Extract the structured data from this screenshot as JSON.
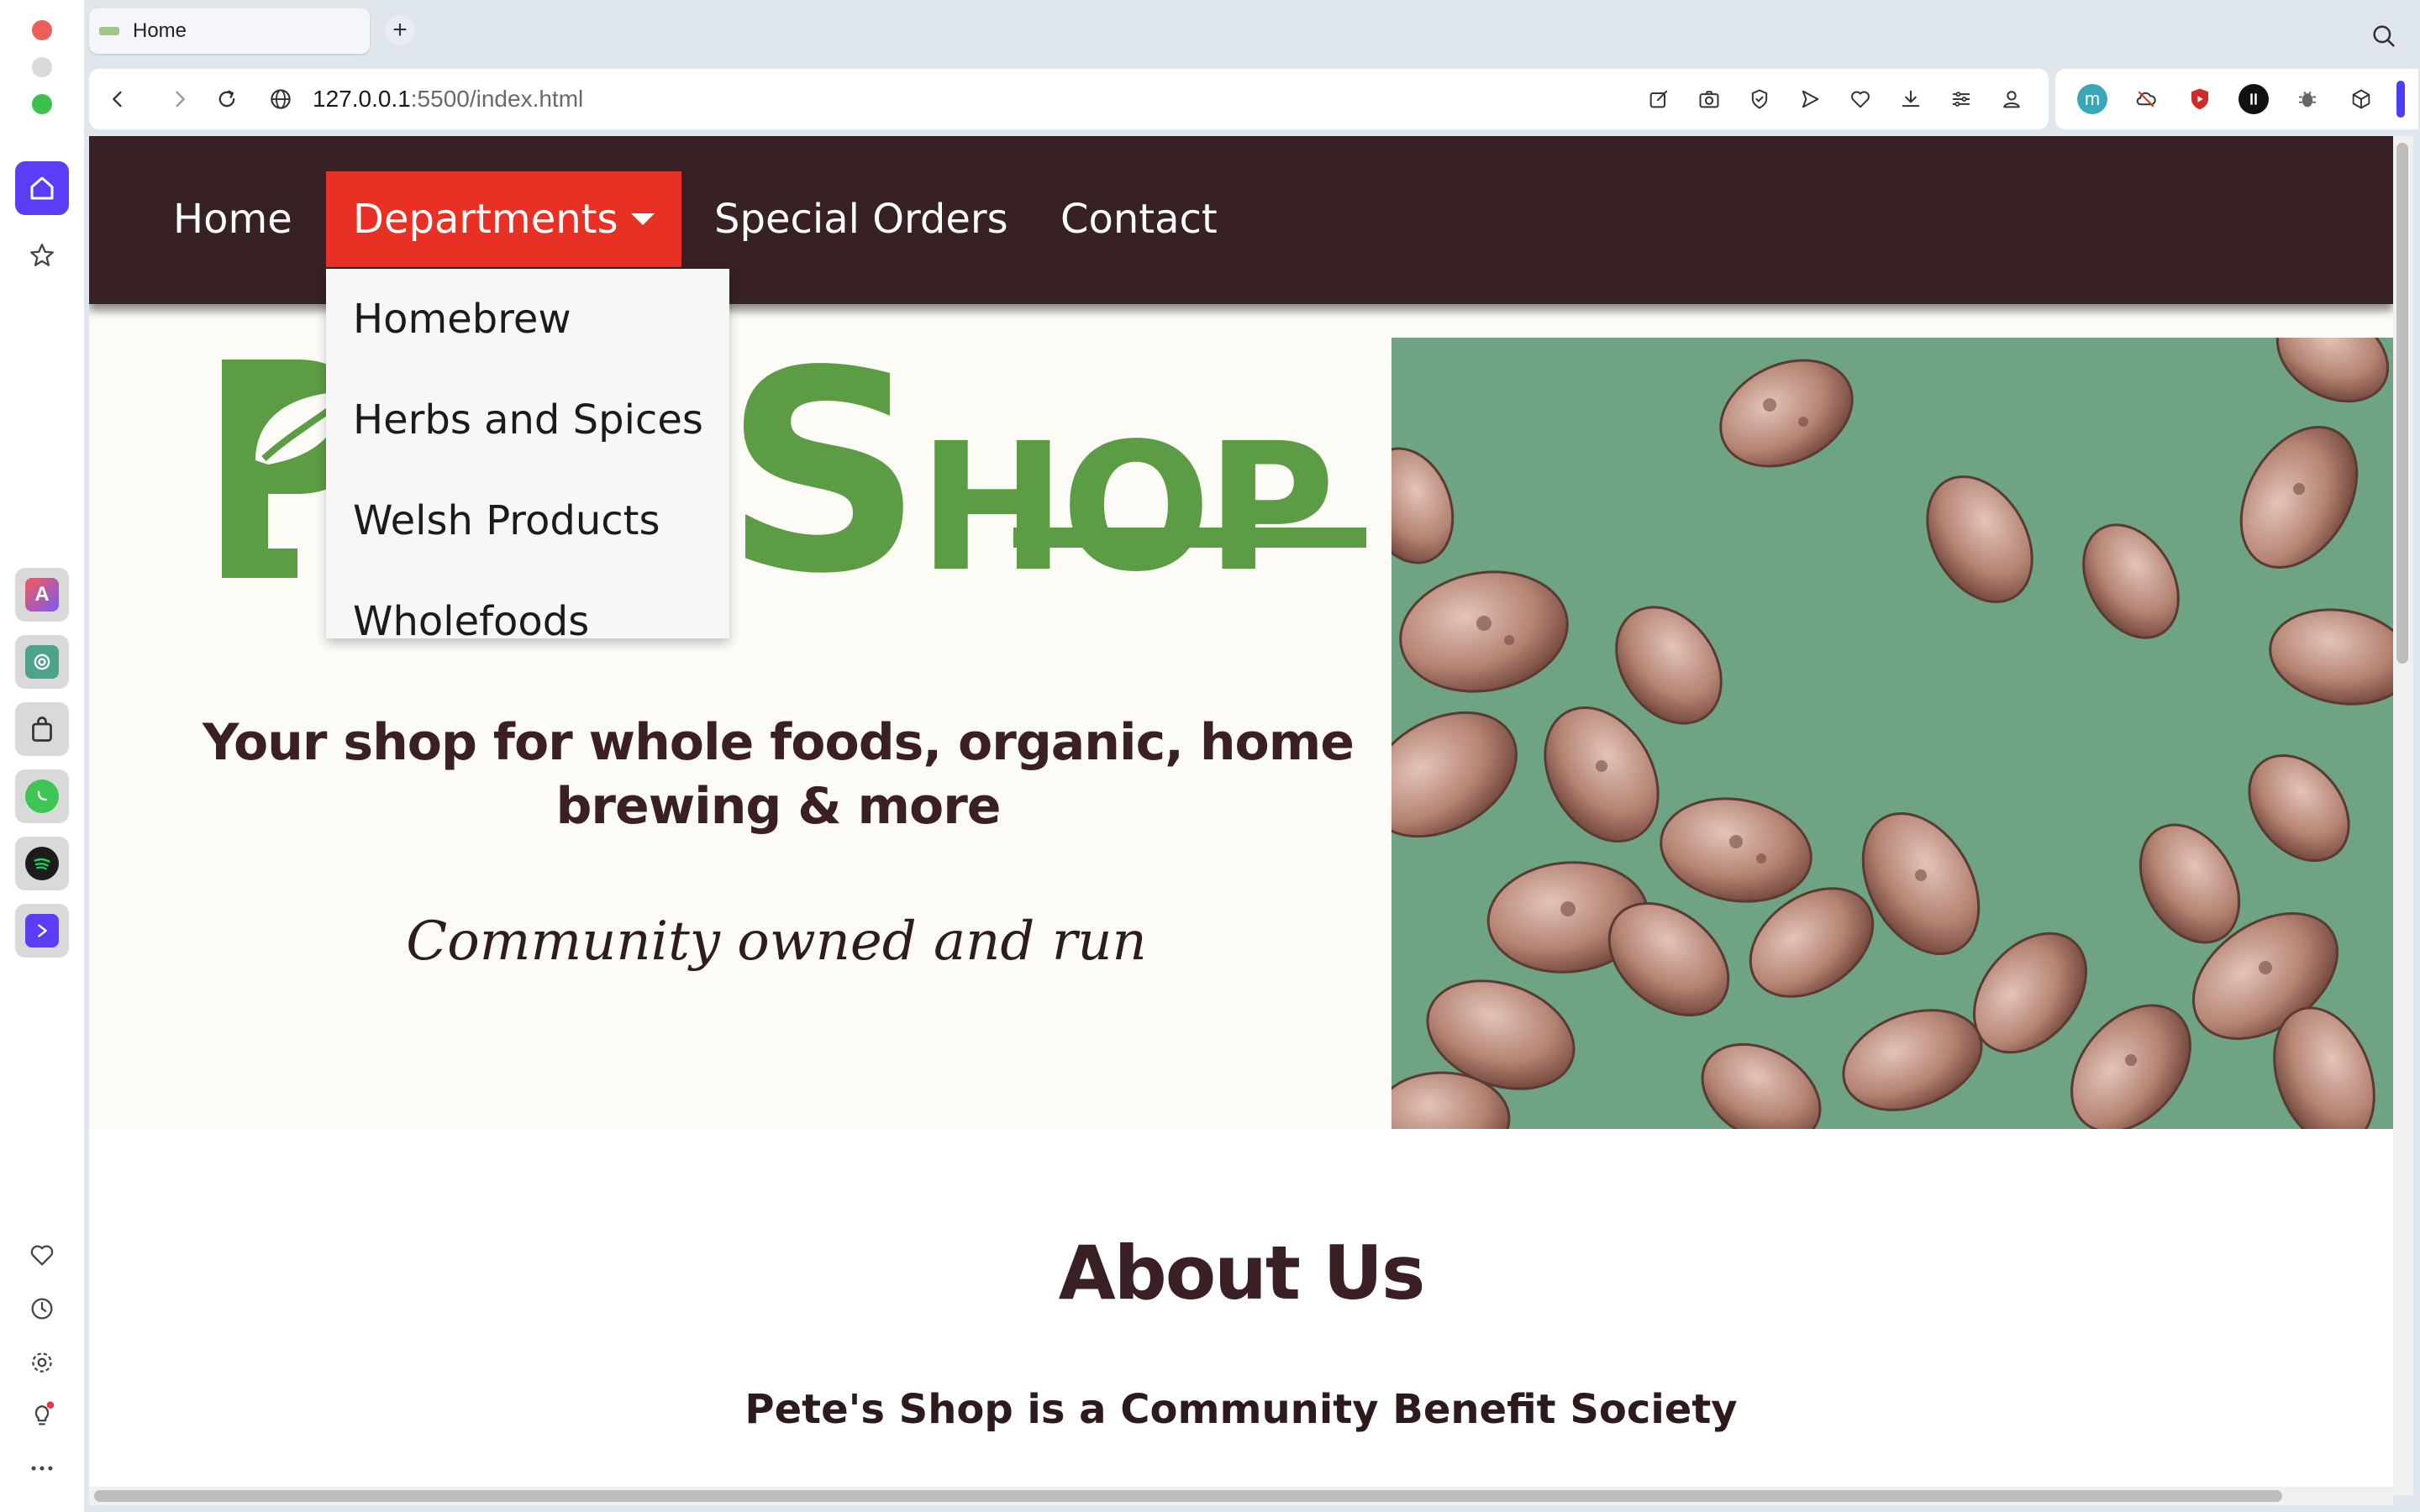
{
  "browser": {
    "tab_title": "Home",
    "new_tab_icon": "+",
    "url_host": "127.0.0.1",
    "url_rest": ":5500/index.html"
  },
  "site": {
    "nav": {
      "home": "Home",
      "departments": "Departments",
      "special_orders": "Special Orders",
      "contact": "Contact"
    },
    "dropdown": [
      "Homebrew",
      "Herbs and Spices",
      "Welsh Products",
      "Wholefoods"
    ],
    "logo": {
      "visible_text_1": "S",
      "visible_text_2": "S",
      "visible_text_3": "HOP"
    },
    "tagline": "Your shop for whole foods, organic, home brewing & more",
    "community": "Community owned and run",
    "about_title": "About Us",
    "about_subtitle": "Pete's Shop is a Community Benefit Society"
  },
  "colors": {
    "nav_bg": "#372124",
    "active_nav": "#e83124",
    "logo_green": "#5c9c45",
    "text_brown": "#3a2024",
    "hero_bg": "#fdfbf6"
  }
}
